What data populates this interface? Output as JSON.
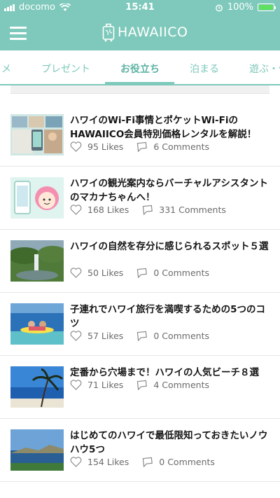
{
  "status_bar": {
    "carrier": "docomo",
    "time": "15:41",
    "battery": "100%",
    "battery_level": 1.0,
    "battery_color": "#5fe060"
  },
  "header": {
    "logo_text": "HAWAIICO",
    "menu_icon": "hamburger-icon",
    "brand_color": "#7ec9bb"
  },
  "tabs": [
    {
      "label": "メ"
    },
    {
      "label": "プレゼント"
    },
    {
      "label": "お役立ち",
      "active": true
    },
    {
      "label": "泊まる"
    },
    {
      "label": "遊ぶ・体"
    }
  ],
  "articles": [
    {
      "title": "ハワイのWi-Fi事情とポケットWi-FiのHAWAIICO会員特別価格レンタルを解説！",
      "likes": "95 Likes",
      "comments": "6 Comments",
      "thumb": "wifi-photos"
    },
    {
      "title": "ハワイの観光案内ならバーチャルアシスタントのマカナちゃんへ！",
      "likes": "168 Likes",
      "comments": "331 Comments",
      "thumb": "assistant-character"
    },
    {
      "title": "ハワイの自然を存分に感じられるスポット５選",
      "likes": "50 Likes",
      "comments": "0 Comments",
      "thumb": "waterfall"
    },
    {
      "title": "子連れでハワイ旅行を満喫するための5つのコツ",
      "likes": "57 Likes",
      "comments": "0 Comments",
      "thumb": "kids-surfing"
    },
    {
      "title": "定番から穴場まで！ハワイの人気ビーチ８選",
      "likes": "71 Likes",
      "comments": "4 Comments",
      "thumb": "palm-beach"
    },
    {
      "title": "はじめてのハワイで最低限知っておきたいノウハウ5つ",
      "likes": "154 Likes",
      "comments": "0 Comments",
      "thumb": "coastline"
    }
  ]
}
